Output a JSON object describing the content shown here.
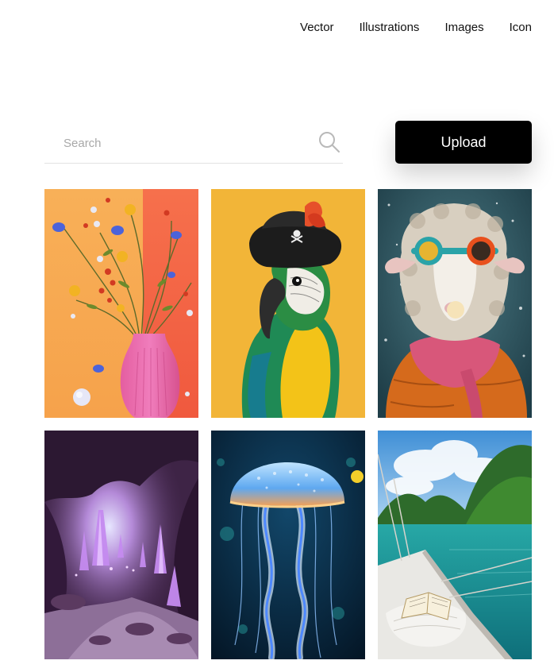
{
  "nav": {
    "items": [
      "Vector",
      "Illustrations",
      "Images",
      "Icon"
    ]
  },
  "search": {
    "placeholder": "Search",
    "value": ""
  },
  "upload": {
    "label": "Upload"
  },
  "gallery": {
    "images": [
      "flower-vase-illustration",
      "pirate-parrot-portrait",
      "sheep-with-goggles-portrait",
      "purple-crystal-cave",
      "glowing-jellyfish",
      "sailboat-tropical-bay"
    ]
  },
  "colors": {
    "button_bg": "#000000",
    "button_text": "#ffffff",
    "divider": "#e3e3e3"
  }
}
